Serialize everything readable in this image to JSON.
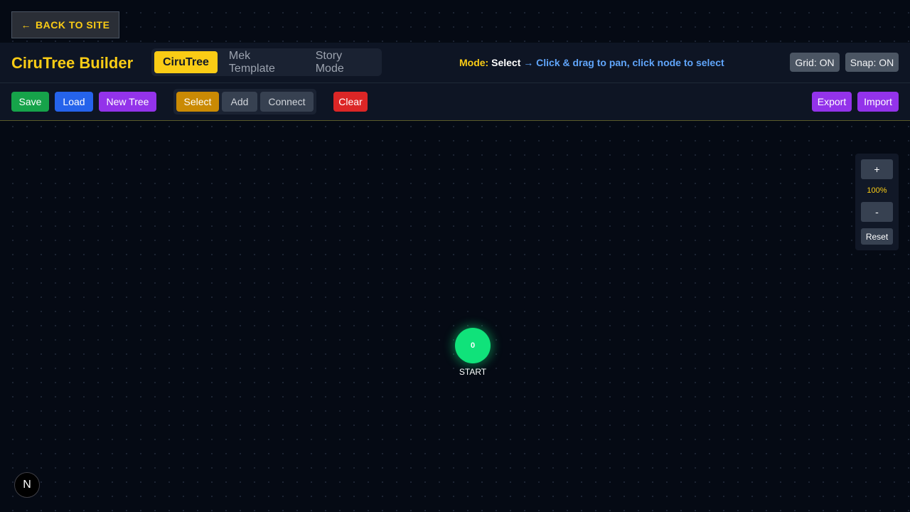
{
  "back_button": {
    "arrow": "←",
    "label": "BACK TO SITE"
  },
  "header": {
    "title": "CiruTree Builder",
    "tabs": [
      {
        "label": "CiruTree",
        "active": true
      },
      {
        "label": "Mek Template",
        "active": false
      },
      {
        "label": "Story Mode",
        "active": false
      }
    ],
    "mode": {
      "label": "Mode:",
      "value": "Select",
      "hint": "→ Click & drag to pan, click node to select"
    },
    "grid_toggle": "Grid: ON",
    "snap_toggle": "Snap: ON"
  },
  "toolbar": {
    "save": "Save",
    "load": "Load",
    "new_tree": "New Tree",
    "modes": [
      {
        "label": "Select",
        "active": true
      },
      {
        "label": "Add",
        "active": false
      },
      {
        "label": "Connect",
        "active": false
      }
    ],
    "clear": "Clear",
    "export": "Export",
    "import": "Import"
  },
  "zoom": {
    "in": "+",
    "level": "100%",
    "out": "-",
    "reset": "Reset"
  },
  "canvas": {
    "start_node": {
      "value": "0",
      "label": "START"
    }
  },
  "badge": {
    "letter": "N"
  }
}
